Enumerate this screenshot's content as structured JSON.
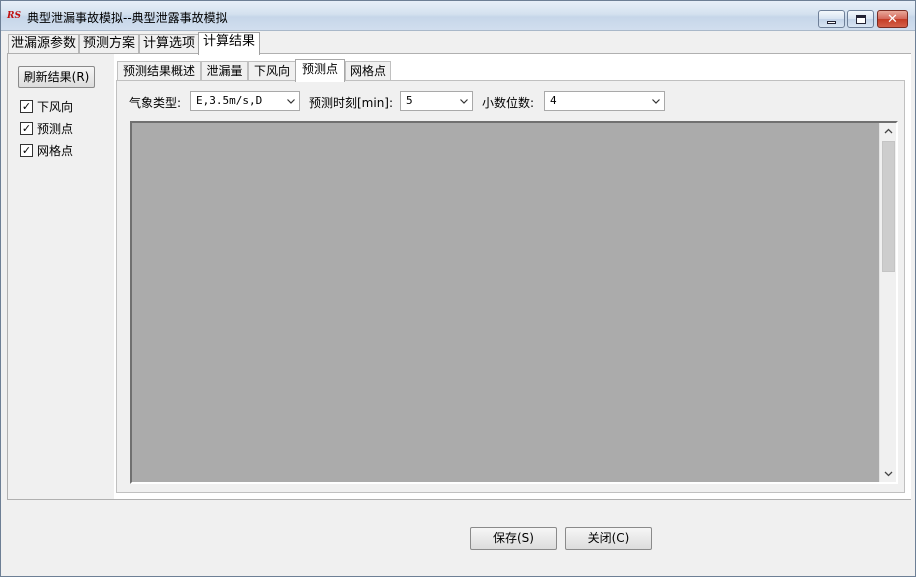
{
  "window": {
    "title": "典型泄漏事故模拟--典型泄露事故模拟",
    "icon_text": "RS",
    "close_glyph": "✕"
  },
  "outer_tabs": [
    {
      "label": "泄漏源参数",
      "active": false
    },
    {
      "label": "预测方案",
      "active": false
    },
    {
      "label": "计算选项",
      "active": false
    },
    {
      "label": "计算结果",
      "active": true
    }
  ],
  "left_pane": {
    "refresh_label": "刷新结果(R)",
    "checkboxes": [
      {
        "label": "下风向",
        "checked": true
      },
      {
        "label": "预测点",
        "checked": true
      },
      {
        "label": "网格点",
        "checked": true
      }
    ],
    "check_glyph": "✓"
  },
  "inner_tabs": [
    {
      "label": "预测结果概述",
      "active": false
    },
    {
      "label": "泄漏量",
      "active": false
    },
    {
      "label": "下风向",
      "active": false
    },
    {
      "label": "预测点",
      "active": true
    },
    {
      "label": "网格点",
      "active": false
    }
  ],
  "filters": {
    "weather_label": "气象类型:",
    "weather_value": "E,3.5m/s,D",
    "time_label": "预测时刻[min]:",
    "time_value": "5",
    "decimals_label": "小数位数:",
    "decimals_value": "4"
  },
  "buttons": {
    "save": "保存(S)",
    "close": "关闭(C)"
  },
  "icons": {
    "app": "app-logo-icon",
    "minimize": "minimize-icon",
    "maximize": "maximize-icon",
    "close": "close-icon",
    "dropdown": "chevron-down-icon",
    "scroll_up": "chevron-up-icon",
    "scroll_down": "chevron-down-icon"
  },
  "colors": {
    "grid_background": "#ababab",
    "close_button": "#c43c25"
  }
}
